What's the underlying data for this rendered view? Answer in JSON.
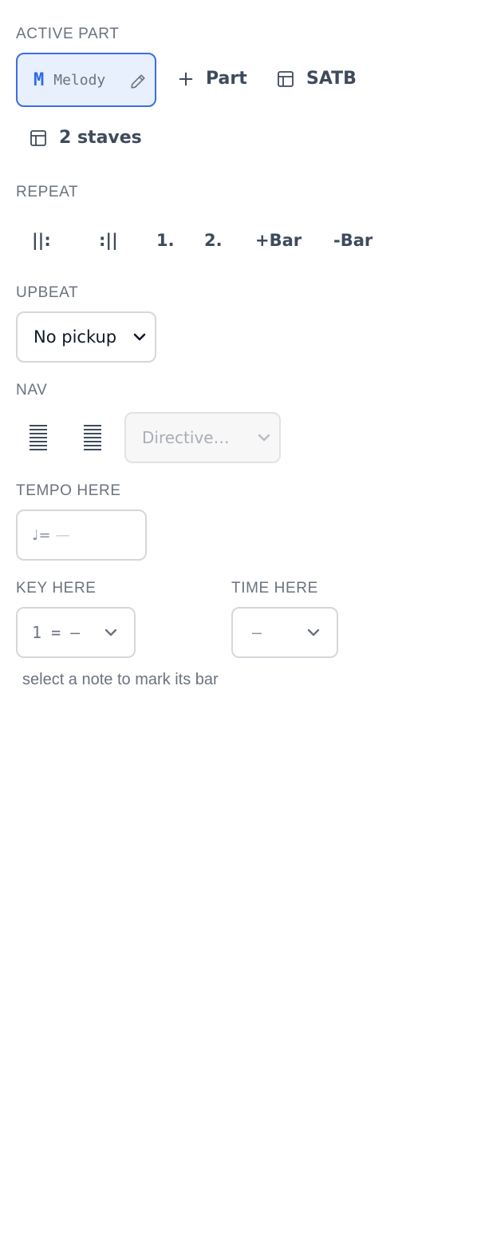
{
  "active_part": {
    "label": "ACTIVE PART",
    "initial": "M",
    "name": "Melody",
    "add_part_label": "Part",
    "satb_label": "SATB",
    "staves_label": "2 staves"
  },
  "repeat": {
    "label": "REPEAT",
    "buttons": [
      "||:",
      ":||",
      "1.",
      "2.",
      "+Bar",
      "-Bar"
    ]
  },
  "upbeat": {
    "label": "UPBEAT",
    "selected": "No pickup"
  },
  "nav": {
    "label": "NAV",
    "directive_placeholder": "Directive…"
  },
  "tempo": {
    "label": "TEMPO HERE",
    "prefix": "♩=",
    "value": "—"
  },
  "key": {
    "label": "KEY HERE",
    "selected": "1 = —"
  },
  "time": {
    "label": "TIME HERE",
    "selected": "—"
  },
  "hint": "select a note to mark its bar",
  "colors": {
    "accent": "#3b6ee0",
    "accent_bg": "#e8effd",
    "label_gray": "#6b7280",
    "button_text": "#3f4a5c"
  }
}
